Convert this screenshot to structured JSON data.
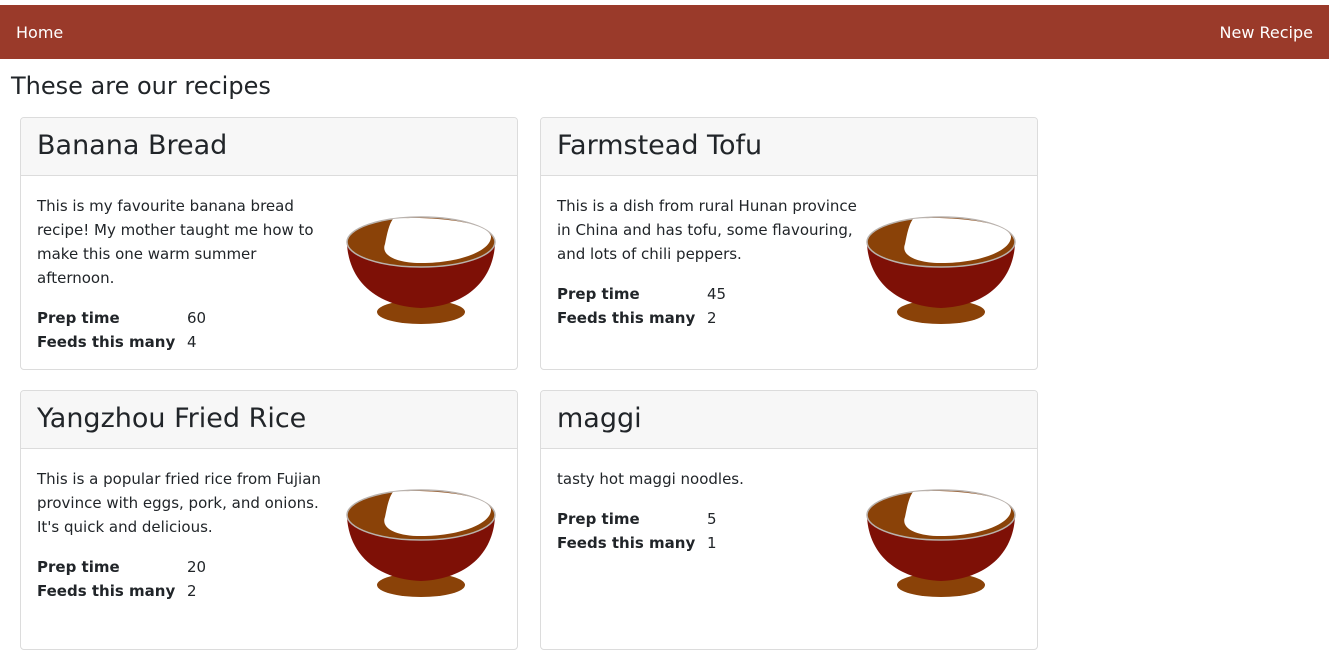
{
  "nav": {
    "home_label": "Home",
    "new_recipe_label": "New Recipe"
  },
  "page": {
    "heading": "These are our recipes"
  },
  "labels": {
    "prep_time": "Prep time",
    "feeds": "Feeds this many"
  },
  "recipes": [
    {
      "title": "Banana Bread",
      "description": "This is my favourite banana bread recipe! My mother taught me how to make this one warm summer afternoon.",
      "prep_time": "60",
      "feeds": "4",
      "image_icon": "bowl-icon"
    },
    {
      "title": "Farmstead Tofu",
      "description": "This is a dish from rural Hunan province in China and has tofu, some flavouring, and lots of chili peppers.",
      "prep_time": "45",
      "feeds": "2",
      "image_icon": "bowl-icon"
    },
    {
      "title": "Yangzhou Fried Rice",
      "description": "This is a popular fried rice from Fujian province with eggs, pork, and onions. It's quick and delicious.",
      "prep_time": "20",
      "feeds": "2",
      "image_icon": "bowl-icon"
    },
    {
      "title": "maggi",
      "description": "tasty hot maggi noodles.",
      "prep_time": "5",
      "feeds": "1",
      "image_icon": "bowl-icon"
    }
  ],
  "colors": {
    "navbar": "#9a3a2a",
    "bowl_body": "#7e1006",
    "bowl_base": "#8a4208"
  }
}
